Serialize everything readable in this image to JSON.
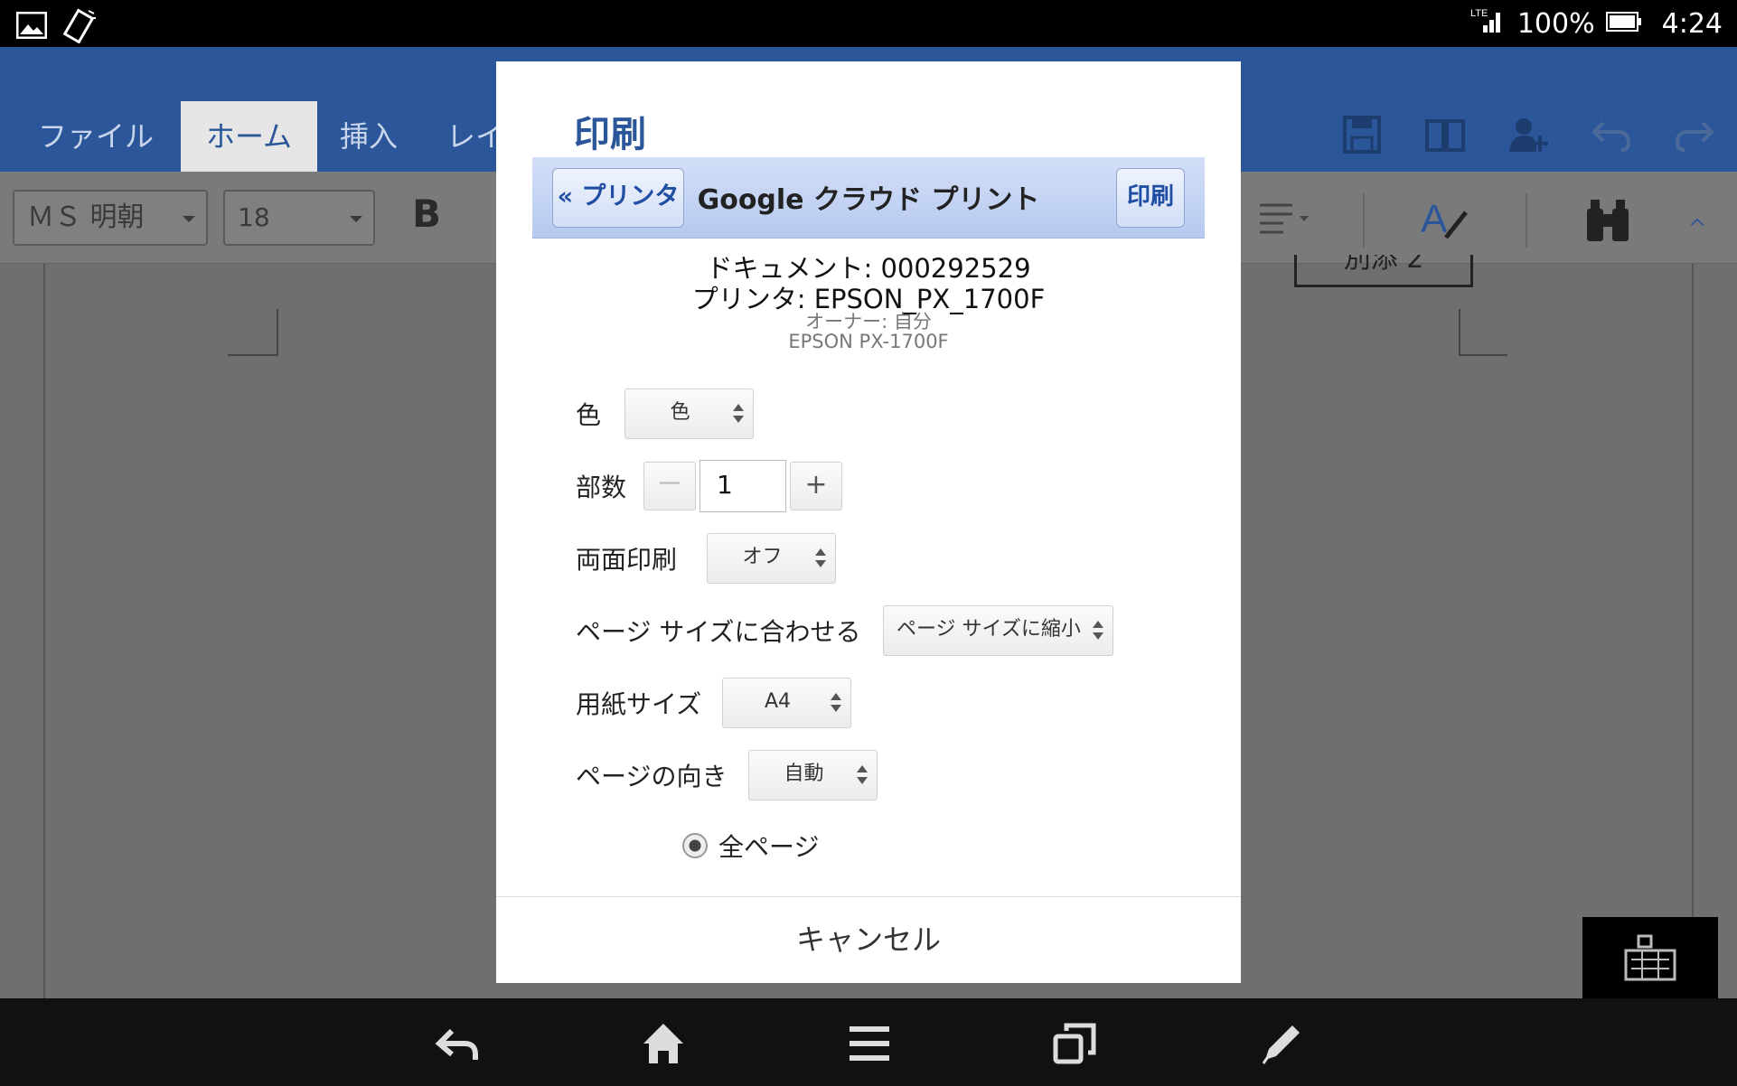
{
  "status_bar": {
    "network": "LTE",
    "battery": "100%",
    "time": "4:24"
  },
  "ribbon": {
    "tabs": [
      "ファイル",
      "ホーム",
      "挿入",
      "レイ"
    ],
    "active_tab": "ホーム",
    "font_name": "ＭＳ 明朝",
    "font_size": "18",
    "bold_label": "B",
    "doc_box_text": "別添 2"
  },
  "dialog": {
    "title": "印刷",
    "gcp": {
      "back_label": "« プリンタ",
      "title": "Google クラウド プリント",
      "print_label": "印刷"
    },
    "info": {
      "document": "ドキュメント: 000292529",
      "printer": "プリンタ: EPSON_PX_1700F",
      "owner": "オーナー: 自分",
      "model": "EPSON PX-1700F"
    },
    "options": {
      "color_label": "色",
      "color_value": "色",
      "copies_label": "部数",
      "copies_value": "1",
      "minus": "－",
      "plus": "+",
      "duplex_label": "両面印刷",
      "duplex_value": "オフ",
      "fit_label": "ページ サイズに合わせる",
      "fit_value": "ページ サイズに縮小",
      "paper_label": "用紙サイズ",
      "paper_value": "A4",
      "orientation_label": "ページの向き",
      "orientation_value": "自動",
      "pages_radio_label": "全ページ"
    },
    "cancel_label": "キャンセル"
  }
}
